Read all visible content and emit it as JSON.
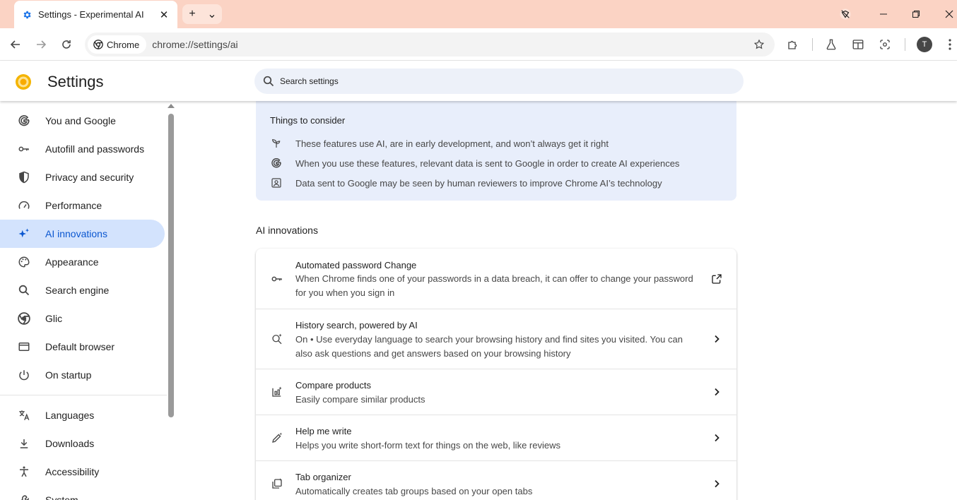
{
  "browser": {
    "tab_title": "Settings - Experimental AI",
    "tab_close_glyph": "✕",
    "new_tab_glyph": "+",
    "tab_search_glyph": "⌄",
    "chip_label": "Chrome",
    "url": "chrome://settings/ai",
    "avatar_initial": "T"
  },
  "settings": {
    "title": "Settings",
    "search_placeholder": "Search settings"
  },
  "sidebar": {
    "items": [
      {
        "label": "You and Google",
        "icon": "google-g-icon"
      },
      {
        "label": "Autofill and passwords",
        "icon": "key-icon"
      },
      {
        "label": "Privacy and security",
        "icon": "shield-icon"
      },
      {
        "label": "Performance",
        "icon": "speedometer-icon"
      },
      {
        "label": "AI innovations",
        "icon": "sparkle-icon",
        "active": true
      },
      {
        "label": "Appearance",
        "icon": "palette-icon"
      },
      {
        "label": "Search engine",
        "icon": "search-icon"
      },
      {
        "label": "Glic",
        "icon": "chrome-icon"
      },
      {
        "label": "Default browser",
        "icon": "browser-window-icon"
      },
      {
        "label": "On startup",
        "icon": "power-icon"
      },
      {
        "label": "Languages",
        "icon": "translate-icon"
      },
      {
        "label": "Downloads",
        "icon": "download-icon"
      },
      {
        "label": "Accessibility",
        "icon": "accessibility-icon"
      },
      {
        "label": "System",
        "icon": "wrench-icon"
      }
    ]
  },
  "consider": {
    "title": "Things to consider",
    "items": [
      {
        "text": "These features use AI, are in early development, and won’t always get it right",
        "icon": "flask-sprout-icon"
      },
      {
        "text": "When you use these features, relevant data is sent to Google in order to create AI experiences",
        "icon": "google-g-icon"
      },
      {
        "text": "Data sent to Google may be seen by human reviewers to improve Chrome AI’s technology",
        "icon": "reviewer-icon"
      }
    ]
  },
  "ai_section": {
    "title": "AI innovations",
    "features": [
      {
        "title": "Automated password Change",
        "desc": "When Chrome finds one of your passwords in a data breach, it can offer to change your password for you when you sign in",
        "icon": "key-icon",
        "action": "external-link-icon"
      },
      {
        "title": "History search, powered by AI",
        "desc": "On • Use everyday language to search your browsing history and find sites you visited. You can also ask questions and get answers based on your browsing history",
        "icon": "sparkle-search-icon",
        "action": "chevron-right-icon"
      },
      {
        "title": "Compare products",
        "desc": "Easily compare similar products",
        "icon": "compare-icon",
        "action": "chevron-right-icon"
      },
      {
        "title": "Help me write",
        "desc": "Helps you write short-form text for things on the web, like reviews",
        "icon": "pen-sparkle-icon",
        "action": "chevron-right-icon"
      },
      {
        "title": "Tab organizer",
        "desc": "Automatically creates tab groups based on your open tabs",
        "icon": "tab-group-icon",
        "action": "chevron-right-icon"
      }
    ]
  },
  "colors": {
    "tabstrip": "#fbd3c4",
    "accent": "#0b57d0",
    "active_nav_bg": "#d3e3fd",
    "consider_bg": "#e8eefb"
  }
}
